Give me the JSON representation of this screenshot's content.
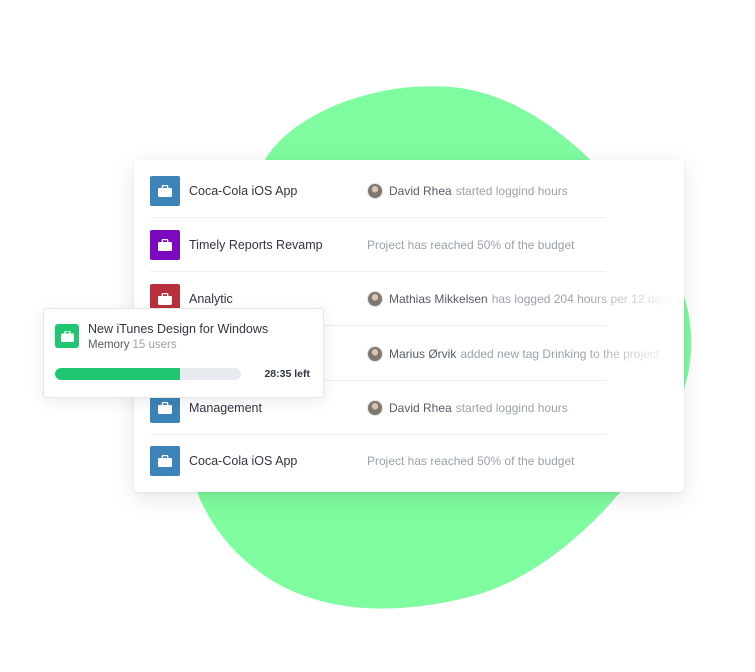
{
  "colors": {
    "blob": "#7ffc9f",
    "accent_green": "#1fc870",
    "blue": "#3c84b7",
    "purple": "#7a09bf",
    "red": "#b9303c"
  },
  "projects": [
    {
      "name": "Coca-Cola iOS App",
      "icon": "briefcase-icon",
      "color": "#3c84b7",
      "activity": {
        "actor": "David Rhea",
        "text": "started loggind hours",
        "avatar": true
      }
    },
    {
      "name": "Timely Reports Revamp",
      "icon": "briefcase-icon",
      "color": "#7a09bf",
      "activity": {
        "actor": "",
        "text": "Project has reached 50% of the budget",
        "avatar": false
      }
    },
    {
      "name": "Analytic",
      "icon": "briefcase-icon",
      "color": "#b9303c",
      "activity": {
        "actor": "Mathias Mikkelsen",
        "text": "has logged 204 hours per 12 days",
        "avatar": true
      }
    },
    {
      "name": "",
      "icon": "briefcase-icon",
      "color": "#3c84b7",
      "activity": {
        "actor": "Marius Ørvik",
        "text": "added new tag Drinking to the project",
        "avatar": true
      }
    },
    {
      "name": "Management",
      "icon": "briefcase-icon",
      "color": "#3c84b7",
      "activity": {
        "actor": "David Rhea",
        "text": "started loggind hours",
        "avatar": true
      }
    },
    {
      "name": "Coca-Cola iOS App",
      "icon": "briefcase-icon",
      "color": "#3c84b7",
      "activity": {
        "actor": "",
        "text": "Project has reached 50% of the budget",
        "avatar": false
      }
    }
  ],
  "popup": {
    "title": "New iTunes Design for Windows",
    "group": "Memory",
    "users": "15 users",
    "icon": "briefcase-icon",
    "progress": 0.67,
    "time_left": "28:35 left"
  }
}
